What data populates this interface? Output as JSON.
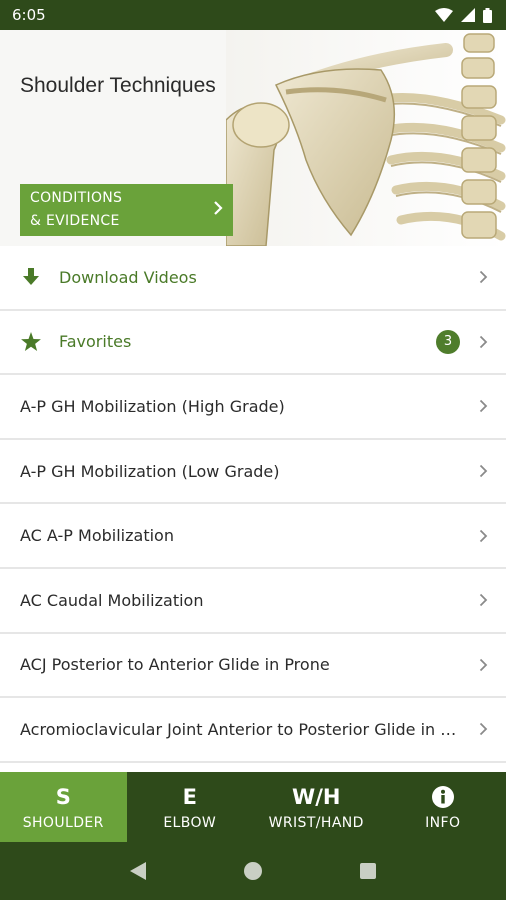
{
  "status_bar": {
    "time": "6:05"
  },
  "hero": {
    "title": "Shoulder Techniques",
    "conditions_button": "CONDITIONS\n& EVIDENCE"
  },
  "list": {
    "download": {
      "label": "Download Videos"
    },
    "favorites": {
      "label": "Favorites",
      "count": "3"
    },
    "items": [
      {
        "label": "A-P GH Mobilization (High Grade)"
      },
      {
        "label": "A-P GH Mobilization (Low Grade)"
      },
      {
        "label": "AC A-P Mobilization"
      },
      {
        "label": "AC Caudal Mobilization"
      },
      {
        "label": "ACJ Posterior to Anterior Glide in Prone"
      },
      {
        "label": "Acromioclavicular Joint Anterior to Posterior Glide in Sitting"
      }
    ]
  },
  "tabs": [
    {
      "abbr": "S",
      "label": "SHOULDER",
      "active": true
    },
    {
      "abbr": "E",
      "label": "ELBOW",
      "active": false
    },
    {
      "abbr": "W/H",
      "label": "WRIST/HAND",
      "active": false
    },
    {
      "abbr": "info-icon",
      "label": "INFO",
      "active": false
    }
  ],
  "colors": {
    "dark_green": "#2e4a1a",
    "accent_green": "#6aa23a",
    "text_green": "#4a7a28"
  }
}
